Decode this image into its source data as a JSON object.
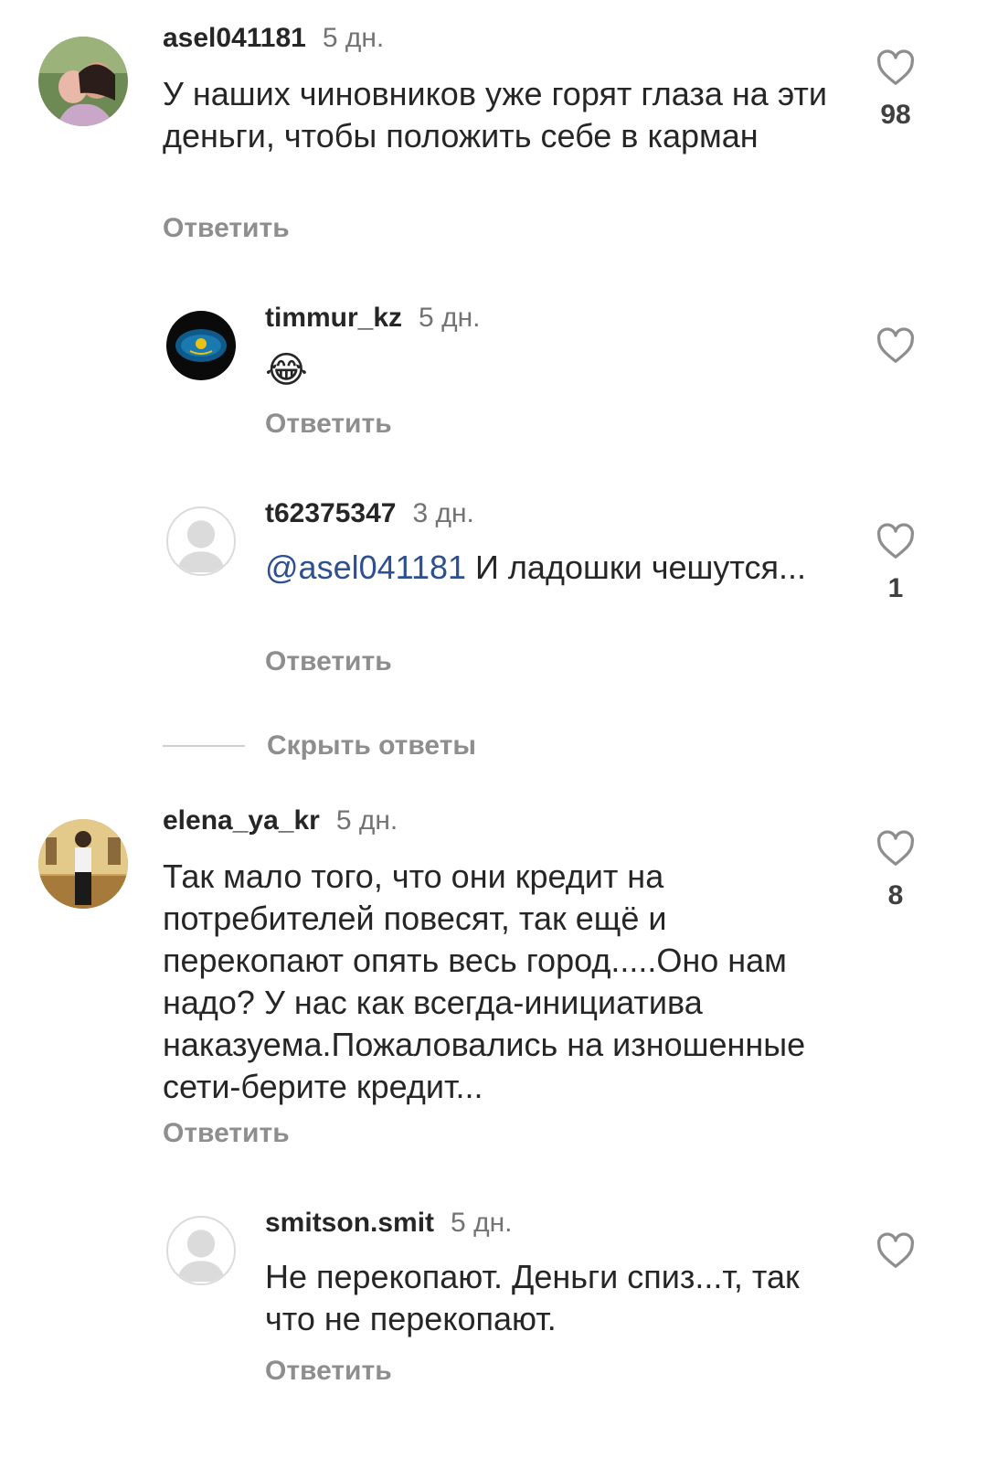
{
  "comments": [
    {
      "username": "asel041181",
      "time": "5 дн.",
      "text": "У наших чиновников уже горят глаза на эти деньги, чтобы положить себе в карман",
      "reply_label": "Ответить",
      "likes": "98"
    },
    {
      "username": "timmur_kz",
      "time": "5 дн.",
      "text": "😂",
      "reply_label": "Ответить",
      "likes": ""
    },
    {
      "username": "t62375347",
      "time": "3 дн.",
      "mention": "@asel041181",
      "text": " И ладошки чешутся...",
      "reply_label": "Ответить",
      "likes": "1"
    },
    {
      "username": "elena_ya_kr",
      "time": "5 дн.",
      "text": "Так мало того, что они кредит на потребителей повесят, так ещё и перекопают опять весь город.....Оно нам надо? У нас как всегда-инициатива наказуема.Пожаловались на изношенные сети-берите кредит...",
      "reply_label": "Ответить",
      "likes": "8"
    },
    {
      "username": "smitson.smit",
      "time": "5 дн.",
      "text": "Не перекопают. Деньги спиз...т, так что не перекопают.",
      "reply_label": "Ответить",
      "likes": ""
    }
  ],
  "hide_replies_label": "Скрыть ответы",
  "icons": {
    "like": "heart-outline-icon",
    "default_avatar": "default-avatar-icon"
  },
  "colors": {
    "text": "#262626",
    "secondary": "#737373",
    "reply_link": "#8e8e8e",
    "mention": "#2e4f90"
  }
}
